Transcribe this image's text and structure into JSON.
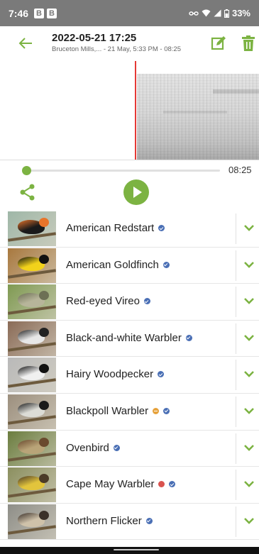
{
  "status_bar": {
    "time": "7:46",
    "badges": [
      "B",
      "B"
    ],
    "battery": "33%",
    "icons": [
      "link-icon",
      "wifi-icon",
      "signal-icon",
      "battery-icon"
    ]
  },
  "header": {
    "title": "2022-05-21 17:25",
    "subtitle": "Bruceton Mills,... - 21 May, 5:33 PM - 08:25",
    "back_icon": "arrow-left-icon",
    "edit_icon": "edit-icon",
    "delete_icon": "trash-icon"
  },
  "player": {
    "duration": "08:25",
    "progress": 0.0,
    "share_icon": "share-icon",
    "play_icon": "play-icon"
  },
  "colors": {
    "accent": "#7cb342",
    "verified": "#4a6fb5",
    "playhead": "#e53935",
    "warn_orange": "#e6a23c",
    "warn_red": "#d9534f"
  },
  "species": [
    {
      "name": "American Redstart",
      "markers": [
        "verified"
      ],
      "bg": "#9fb7a8",
      "body": "#1a1a1a",
      "accent": "#e8742a"
    },
    {
      "name": "American Goldfinch",
      "markers": [
        "verified"
      ],
      "bg": "#a8783e",
      "body": "#f2d21b",
      "accent": "#111111"
    },
    {
      "name": "Red-eyed Vireo",
      "markers": [
        "verified"
      ],
      "bg": "#7f9a52",
      "body": "#b7b59a",
      "accent": "#6d7055"
    },
    {
      "name": "Black-and-white Warbler",
      "markers": [
        "verified"
      ],
      "bg": "#8a6b57",
      "body": "#e7e7e7",
      "accent": "#222222"
    },
    {
      "name": "Hairy Woodpecker",
      "markers": [
        "verified"
      ],
      "bg": "#b9b9b9",
      "body": "#f0f0f0",
      "accent": "#111111"
    },
    {
      "name": "Blackpoll Warbler",
      "markers": [
        "orange",
        "verified"
      ],
      "bg": "#9c8f7e",
      "body": "#dcdcd6",
      "accent": "#1a1a1a"
    },
    {
      "name": "Ovenbird",
      "markers": [
        "verified"
      ],
      "bg": "#6b7d3f",
      "body": "#b9a478",
      "accent": "#6a4a2e"
    },
    {
      "name": "Cape May Warbler",
      "markers": [
        "red",
        "verified"
      ],
      "bg": "#8b8f5f",
      "body": "#e2c43c",
      "accent": "#4b3b28"
    },
    {
      "name": "Northern Flicker",
      "markers": [
        "verified"
      ],
      "bg": "#8e8e88",
      "body": "#cfc2aa",
      "accent": "#3a3029"
    }
  ]
}
